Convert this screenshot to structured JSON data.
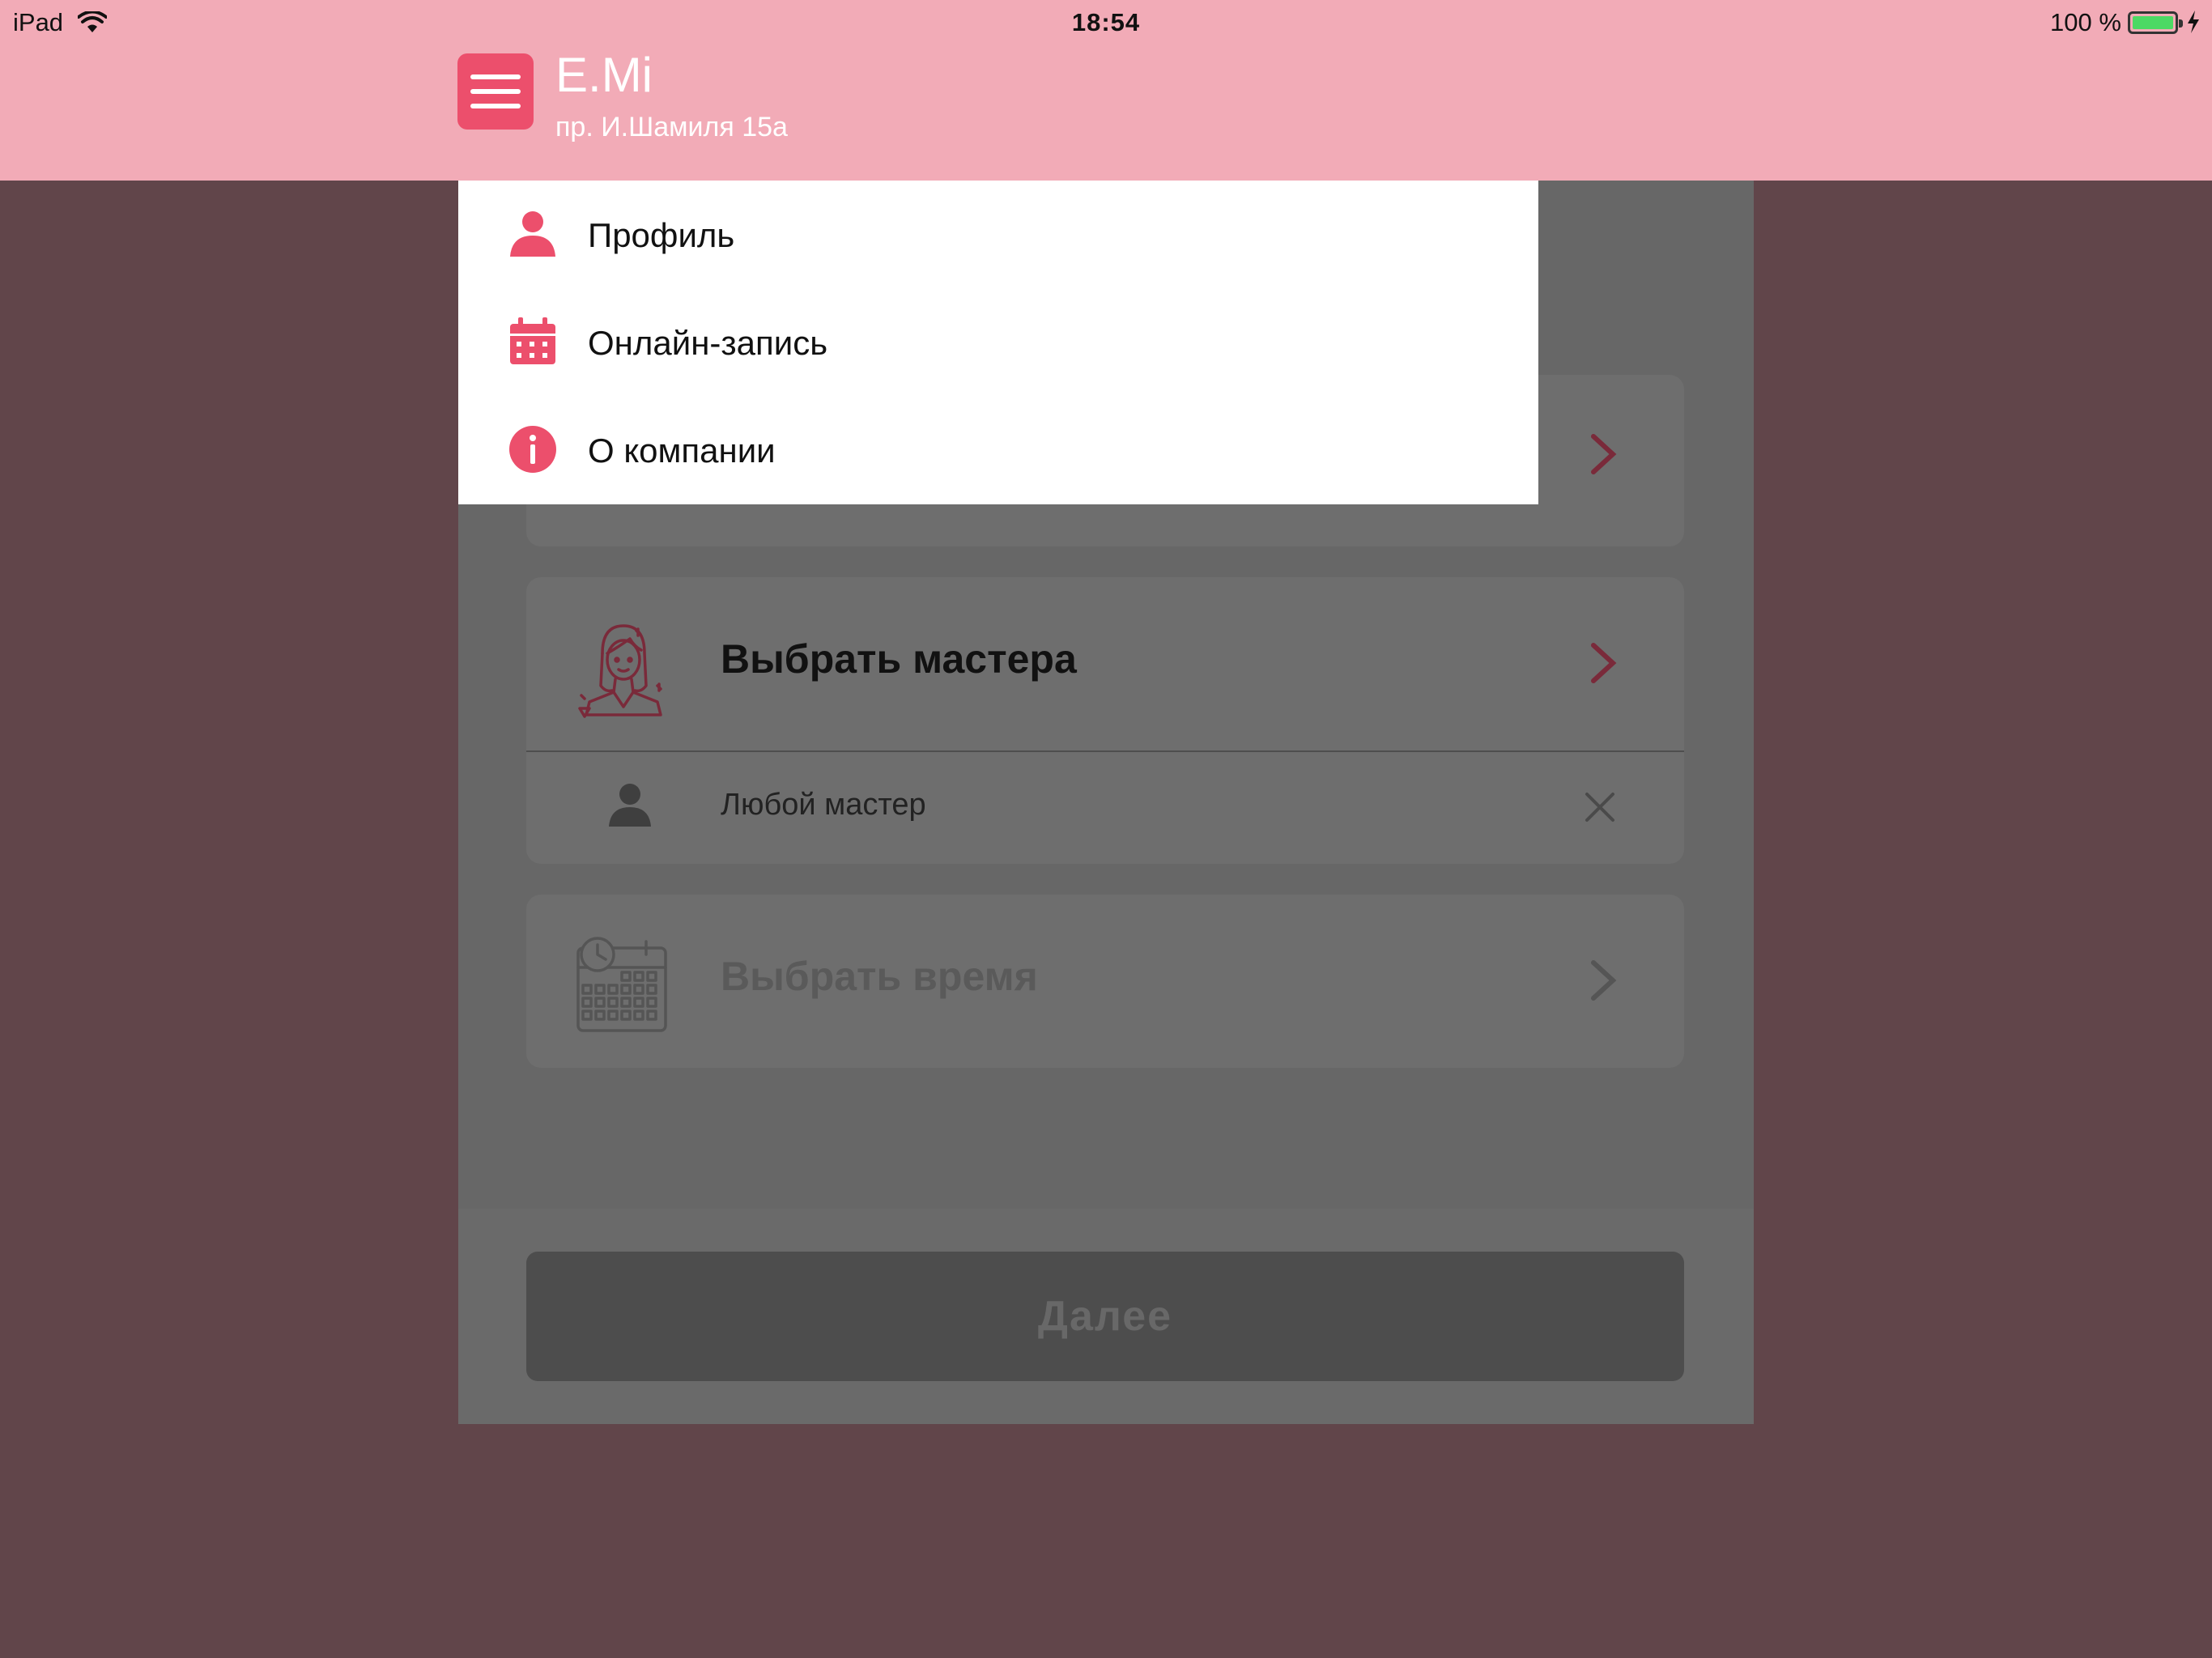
{
  "status_bar": {
    "device": "iPad",
    "time": "18:54",
    "battery_text": "100 %"
  },
  "header": {
    "title": "E.Mi",
    "subtitle": "пр. И.Шамиля 15а"
  },
  "menu": {
    "items": [
      {
        "label": "Профиль",
        "icon": "person-icon"
      },
      {
        "label": "Онлайн-запись",
        "icon": "calendar-icon"
      },
      {
        "label": "О компании",
        "icon": "info-icon"
      }
    ]
  },
  "booking": {
    "master_title": "Выбрать мастера",
    "selected_master": "Любой мастер",
    "time_title": "Выбрать время",
    "next_label": "Далее"
  },
  "colors": {
    "header_bg": "#f2abb7",
    "accent": "#ec4f6c",
    "overlay": "#61454a",
    "chevron": "#7a2a3a"
  }
}
